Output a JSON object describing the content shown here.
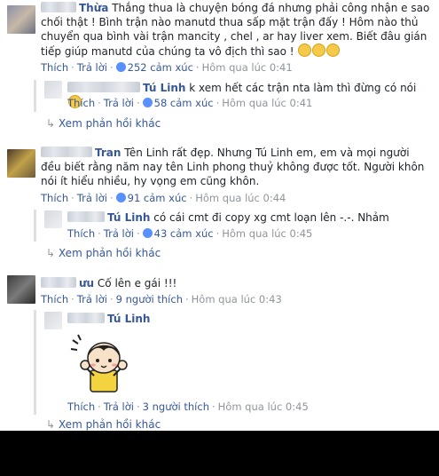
{
  "comments": [
    {
      "name": "Thừa",
      "text": "Thắng thua là chuyện bóng đá nhưng phải công nhận e sao chối thật ! Bình trận nào manutd thua sấp mặt trận đấy ! Hôm nào thủ chuyển qua bình vài trận mancity , chel , ar hay liver xem. Biết đâu gián tiếp giúp manutd của chúng ta vô địch thì sao !",
      "like": "Thích",
      "reply": "Trả lời",
      "reactions": "252 cảm xúc",
      "time": "Hôm qua lúc 0:41",
      "replies": [
        {
          "name": "Tú Linh",
          "text": "k xem hết các trận nta làm thì đừng có nói",
          "like": "Thích",
          "reply": "Trả lời",
          "reactions": "58 cảm xúc",
          "time": "Hôm qua lúc 0:41"
        }
      ],
      "more_replies": "Xem phản hồi khác"
    },
    {
      "name": "Tran",
      "text": "Tên Linh rất đẹp. Nhưng Tú Linh em, em và mọi người đều biết rằng năm nay tên Linh phong thuỷ không được tốt. Người khôn nói ít hiểu nhiều, hy vọng em cũng khôn.",
      "like": "Thích",
      "reply": "Trả lời",
      "reactions": "91 cảm xúc",
      "time": "Hôm qua lúc 0:44",
      "replies": [
        {
          "name": "Tú Linh",
          "text": "có cái cmt đi copy xg cmt loạn lên -.-. Nhảm",
          "like": "Thích",
          "reply": "Trả lời",
          "reactions": "43 cảm xúc",
          "time": "Hôm qua lúc 0:45"
        }
      ],
      "more_replies": "Xem phản hồi khác"
    },
    {
      "name": "ưu",
      "text": "Cố lên e gái !!!",
      "like": "Thích",
      "reply": "Trả lời",
      "reactions": "9 người thích",
      "time": "Hôm qua lúc 0:43",
      "replies": [
        {
          "name": "Tú Linh",
          "like": "Thích",
          "reply": "Trả lời",
          "reactions": "3 người thích",
          "time": "Hôm qua lúc 0:45"
        }
      ],
      "more_replies": "Xem phản hồi khác"
    }
  ],
  "colors": {
    "link": "#365899",
    "meta": "#90949c",
    "text": "#1d2129",
    "like_blue": "#5890ff"
  }
}
